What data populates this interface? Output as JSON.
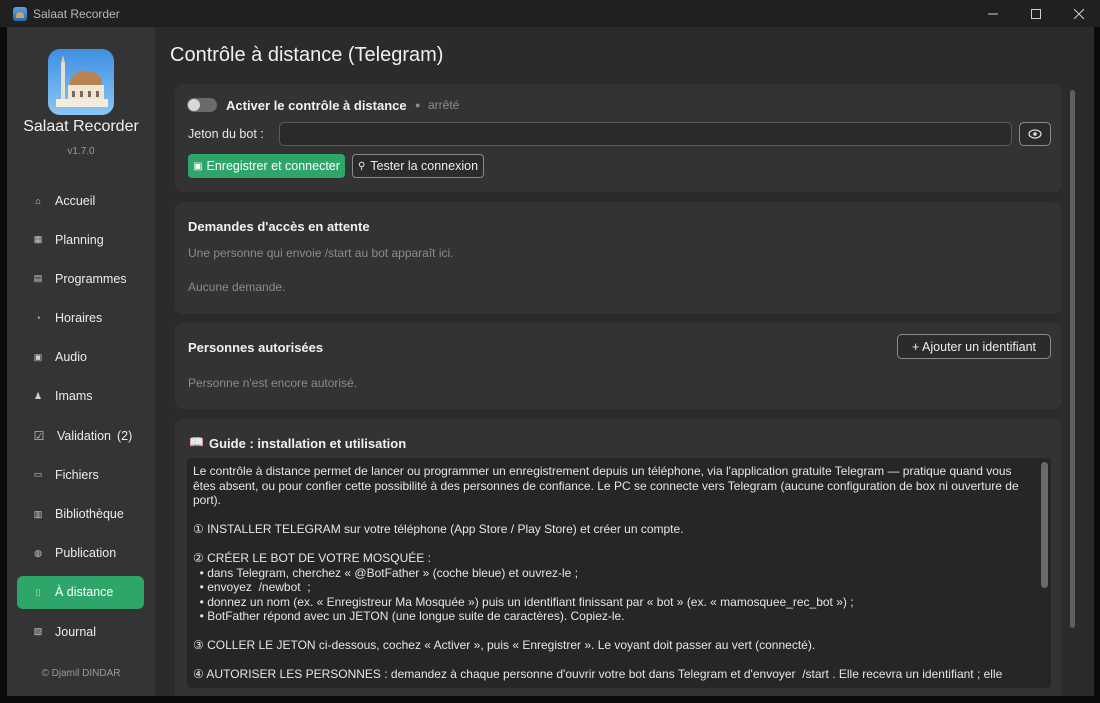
{
  "window": {
    "title": "Salaat Recorder",
    "minimize": "—",
    "maximize": "☐",
    "close": "✕"
  },
  "sidebar": {
    "brand": "Salaat Recorder",
    "version": "v1.7.0",
    "items": [
      {
        "label": "Accueil",
        "icon": "home-icon",
        "glyph": "⌂"
      },
      {
        "label": "Planning",
        "icon": "calendar-icon",
        "glyph": "▦"
      },
      {
        "label": "Programmes",
        "icon": "programs-icon",
        "glyph": "▤"
      },
      {
        "label": "Horaires",
        "icon": "clock-icon",
        "glyph": "◔"
      },
      {
        "label": "Audio",
        "icon": "audio-icon",
        "glyph": "▣"
      },
      {
        "label": "Imams",
        "icon": "person-icon",
        "glyph": "♟"
      },
      {
        "label": "Validation",
        "icon": "checkbox-icon",
        "glyph": "☑",
        "badge": "(2)"
      },
      {
        "label": "Fichiers",
        "icon": "folder-icon",
        "glyph": "▭"
      },
      {
        "label": "Bibliothèque",
        "icon": "library-icon",
        "glyph": "▥"
      },
      {
        "label": "Publication",
        "icon": "globe-icon",
        "glyph": "◍"
      },
      {
        "label": "À distance",
        "icon": "phone-icon",
        "glyph": "▯",
        "active": true
      },
      {
        "label": "Journal",
        "icon": "journal-icon",
        "glyph": "▧"
      }
    ],
    "copyright": "© Djamil DINDAR"
  },
  "main": {
    "title": "Contrôle à distance (Telegram)",
    "remote": {
      "toggle_label": "Activer le contrôle à distance",
      "status_dot": "●",
      "status": "arrêté",
      "token_label": "Jeton du bot :",
      "token_value": "",
      "eye_icon": "eye-icon",
      "save_connect": "Enregistrer et connecter",
      "test": "Tester la connexion"
    },
    "pending": {
      "title": "Demandes d'accès en attente",
      "hint": "Une personne qui envoie /start au bot apparaît ici.",
      "empty": "Aucune demande."
    },
    "authorized": {
      "title": "Personnes autorisées",
      "add_button": "+  Ajouter un identifiant",
      "empty": "Personne n'est encore autorisé."
    },
    "guide": {
      "title": "Guide : installation et utilisation",
      "text": "Le contrôle à distance permet de lancer ou programmer un enregistrement depuis un téléphone, via l'application gratuite Telegram — pratique quand vous êtes absent, ou pour confier cette possibilité à des personnes de confiance. Le PC se connecte vers Telegram (aucune configuration de box ni ouverture de port).\n\n① INSTALLER TELEGRAM sur votre téléphone (App Store / Play Store) et créer un compte.\n\n② CRÉER LE BOT DE VOTRE MOSQUÉE :\n  • dans Telegram, cherchez « @BotFather » (coche bleue) et ouvrez-le ;\n  • envoyez  /newbot  ;\n  • donnez un nom (ex. « Enregistreur Ma Mosquée ») puis un identifiant finissant par « bot » (ex. « mamosquee_rec_bot ») ;\n  • BotFather répond avec un JETON (une longue suite de caractères). Copiez-le.\n\n③ COLLER LE JETON ci-dessous, cochez « Activer », puis « Enregistrer ». Le voyant doit passer au vert (connecté).\n\n④ AUTORISER LES PERSONNES : demandez à chaque personne d'ouvrir votre bot dans Telegram et d'envoyer  /start . Elle recevra un identifiant ; elle"
    }
  }
}
